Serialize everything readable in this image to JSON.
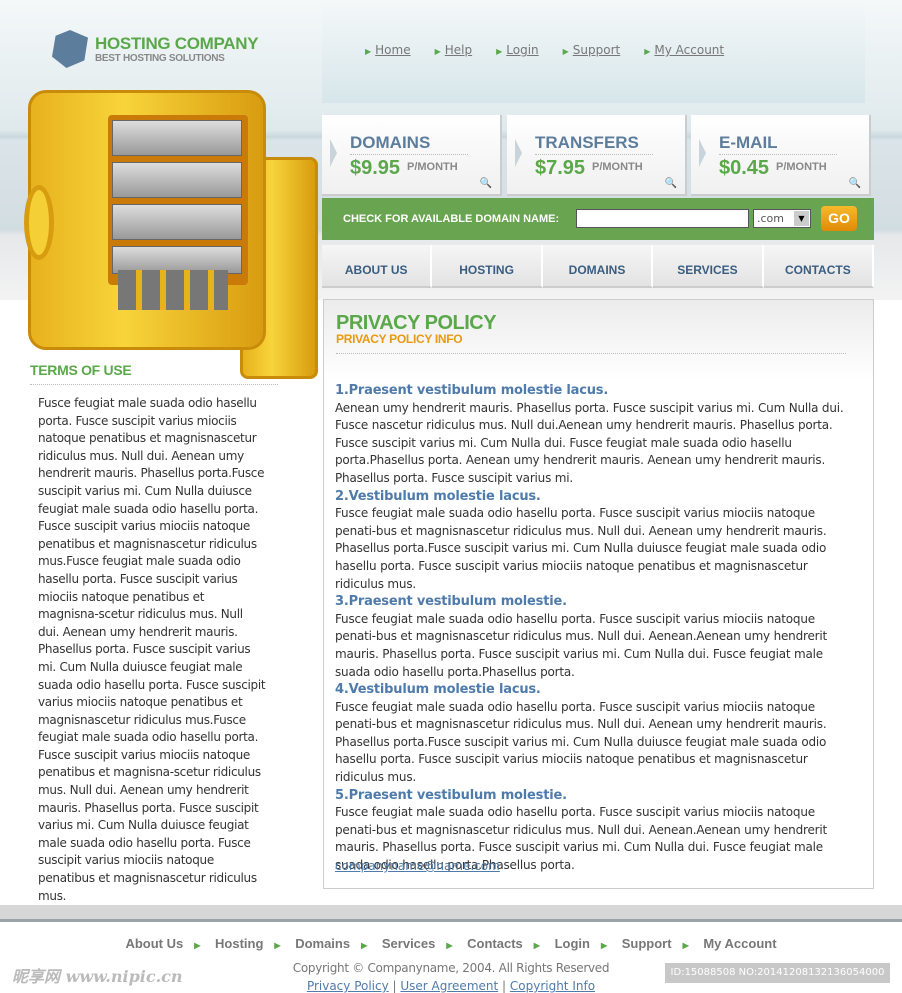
{
  "logo": {
    "title": "HOSTING COMPANY",
    "subtitle": "BEST HOSTING SOLUTIONS"
  },
  "top_nav": [
    "Home",
    "Help",
    "Login",
    "Support",
    "My Account"
  ],
  "price_boxes": [
    {
      "title": "DOMAINS",
      "price": "$9.95",
      "unit": "P/MONTH"
    },
    {
      "title": "TRANSFERS",
      "price": "$7.95",
      "unit": "P/MONTH"
    },
    {
      "title": "E-MAIL",
      "price": "$0.45",
      "unit": "P/MONTH"
    }
  ],
  "domain_search": {
    "label": "CHECK FOR AVAILABLE DOMAIN NAME:",
    "value": "",
    "tld": ".com",
    "go": "GO"
  },
  "menu": [
    "ABOUT US",
    "HOSTING",
    "DOMAINS",
    "SERVICES",
    "CONTACTS"
  ],
  "sidebar": {
    "title": "TERMS OF USE",
    "text": "Fusce feugiat male suada odio hasellu porta. Fusce suscipit varius miociis natoque penatibus et magnisnascetur ridiculus mus. Null dui. Aenean umy hendrerit mauris. Phasellus porta.Fusce suscipit varius mi. Cum  Nulla duiusce feugiat male suada odio hasellu porta. Fusce suscipit varius miociis natoque penatibus et magnisnascetur ridiculus mus.Fusce feugiat male suada odio hasellu porta. Fusce suscipit varius miociis natoque penatibus et magnisna-scetur ridiculus mus. Null dui. Aenean umy hendrerit mauris. Phasellus porta. Fusce suscipit varius mi. Cum  Nulla duiusce feugiat male suada odio hasellu porta. Fusce suscipit varius miociis natoque penatibus et magnisnascetur ridiculus mus.Fusce feugiat male suada odio hasellu porta. Fusce suscipit varius miociis natoque penatibus et magnisna-scetur ridiculus mus. Null dui. Aenean umy hendrerit mauris. Phasellus porta. Fusce suscipit varius mi. Cum  Nulla duiusce feugiat male suada odio hasellu porta. Fusce suscipit varius miociis natoque penatibus et magnisnascetur ridiculus mus."
  },
  "content": {
    "title": "PRIVACY POLICY",
    "subtitle": "PRIVACY POLICY INFO",
    "sections": [
      {
        "heading": "1.Praesent vestibulum molestie lacus.",
        "text": "Aenean umy hendrerit mauris. Phasellus porta. Fusce suscipit varius mi. Cum  Nulla dui. Fusce nascetur ridiculus mus. Null dui.Aenean umy hendrerit mauris. Phasellus porta. Fusce suscipit varius mi. Cum  Nulla dui. Fusce feugiat male suada odio hasellu porta.Phasellus porta. Aenean umy hendrerit mauris. Aenean umy hendrerit mauris. Phasellus porta. Fusce suscipit varius mi."
      },
      {
        "heading": "2.Vestibulum molestie lacus.",
        "text": "Fusce feugiat male suada odio hasellu porta. Fusce suscipit varius miociis natoque penati-bus et magnisnascetur ridiculus mus. Null dui. Aenean umy hendrerit mauris. Phasellus porta.Fusce suscipit varius mi. Cum  Nulla duiusce feugiat male suada odio hasellu porta. Fusce suscipit varius miociis natoque penatibus et magnisnascetur ridiculus mus."
      },
      {
        "heading": "3.Praesent vestibulum molestie.",
        "text": "Fusce feugiat male suada odio hasellu porta. Fusce suscipit varius miociis natoque penati-bus et magnisnascetur ridiculus mus. Null dui. Aenean.Aenean umy hendrerit mauris. Phasellus porta. Fusce suscipit varius mi. Cum  Nulla dui. Fusce feugiat male suada odio hasellu porta.Phasellus porta."
      },
      {
        "heading": "4.Vestibulum molestie lacus.",
        "text": "Fusce feugiat male suada odio hasellu porta. Fusce suscipit varius miociis natoque penati-bus et magnisnascetur ridiculus mus. Null dui. Aenean umy hendrerit mauris. Phasellus porta.Fusce suscipit varius mi. Cum  Nulla duiusce feugiat male suada odio hasellu porta. Fusce suscipit varius miociis natoque penatibus et magnisnascetur ridiculus mus."
      },
      {
        "heading": "5.Praesent vestibulum molestie.",
        "text": "Fusce feugiat male suada odio hasellu porta. Fusce suscipit varius miociis natoque penati-bus et magnisnascetur ridiculus mus. Null dui. Aenean.Aenean umy hendrerit mauris. Phasellus porta. Fusce suscipit varius mi. Cum  Nulla dui. Fusce feugiat male suada odio hasellu porta.Phasellus porta."
      }
    ],
    "email": "companyname@name.com"
  },
  "footer": {
    "nav": [
      "About Us",
      "Hosting",
      "Domains",
      "Services",
      "Contacts",
      "Login",
      "Support",
      "My Account"
    ],
    "copyright": "Copyright © Companyname, 2004. All Rights Reserved",
    "links": [
      "Privacy Policy",
      "User Agreement",
      "Copyright Info"
    ],
    "watermark": "昵享网 www.nipic.cn",
    "id_label": "ID:15088508 NO:20141208132136054000"
  }
}
